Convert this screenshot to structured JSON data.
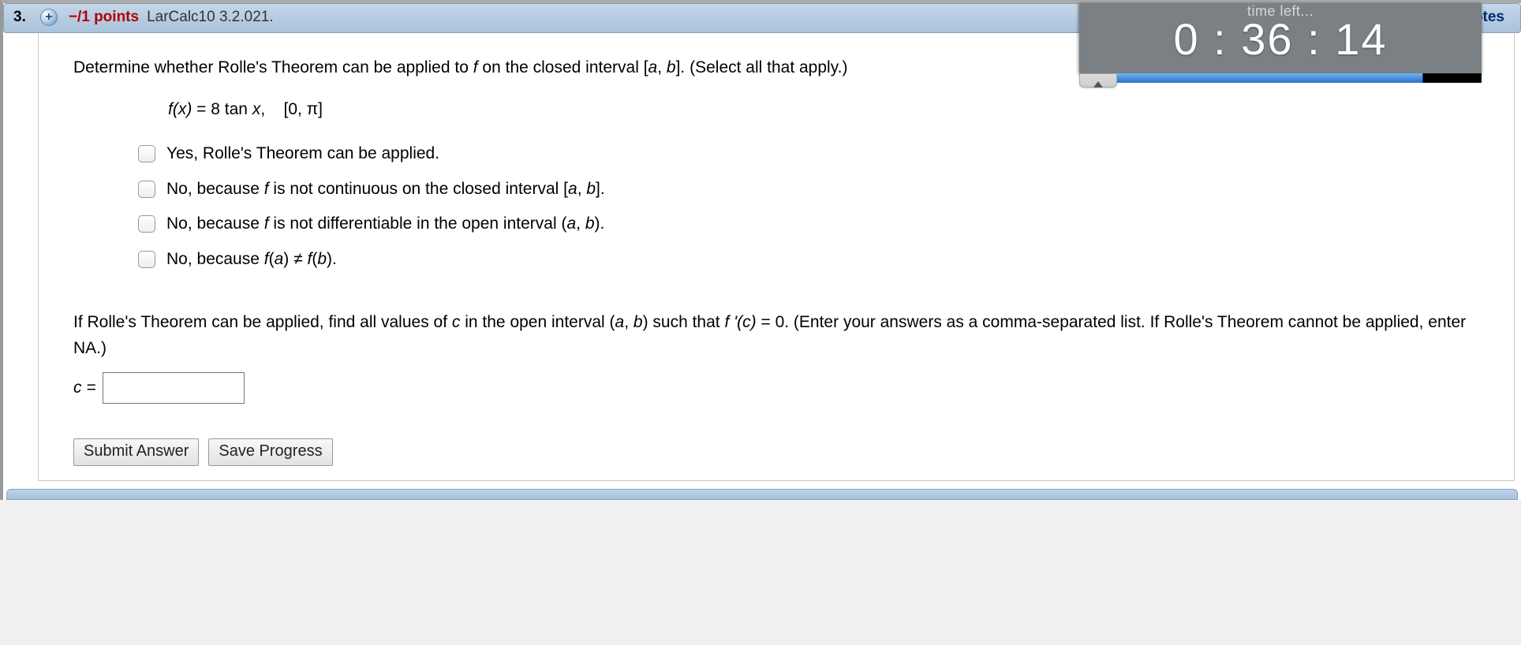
{
  "header": {
    "question_number": "3.",
    "expand_glyph": "+",
    "points_text": "−/1 points",
    "source_ref": "LarCalc10 3.2.021.",
    "my_notes_label": "My Notes"
  },
  "timer": {
    "title": "time left...",
    "time": "0 : 36 : 14",
    "progress_percent": 84
  },
  "question": {
    "prompt_prefix": "Determine whether Rolle's Theorem can be applied to ",
    "prompt_f": "f",
    "prompt_mid": " on the closed interval  [",
    "prompt_a": "a",
    "prompt_comma": ", ",
    "prompt_b": "b",
    "prompt_suffix": "].  (Select all that apply.)",
    "formula_lhs": "f(x)",
    "formula_eq": " = ",
    "formula_coeff": "8",
    "formula_tan": " tan ",
    "formula_x": "x",
    "formula_comma": ",",
    "formula_interval": "[0, π]",
    "choices": [
      "Yes, Rolle's Theorem can be applied.",
      "No, because f is not continuous on the closed interval [a, b].",
      "No, because f is not differentiable in the open interval (a, b).",
      "No, because f(a) ≠ f(b)."
    ],
    "part2_prefix": "If Rolle's Theorem can be applied, find all values of ",
    "part2_c": "c",
    "part2_mid1": " in the open interval  (",
    "part2_a": "a",
    "part2_comma": ", ",
    "part2_b": "b",
    "part2_mid2": ")  such that  ",
    "part2_fprime": "f '(c)",
    "part2_eq0": " = 0.  (Enter your answers as a comma-separated list. If Rolle's Theorem cannot be applied, enter NA.)",
    "c_label_lhs": "c",
    "c_label_eq": " = "
  },
  "buttons": {
    "submit": "Submit Answer",
    "save": "Save Progress"
  }
}
